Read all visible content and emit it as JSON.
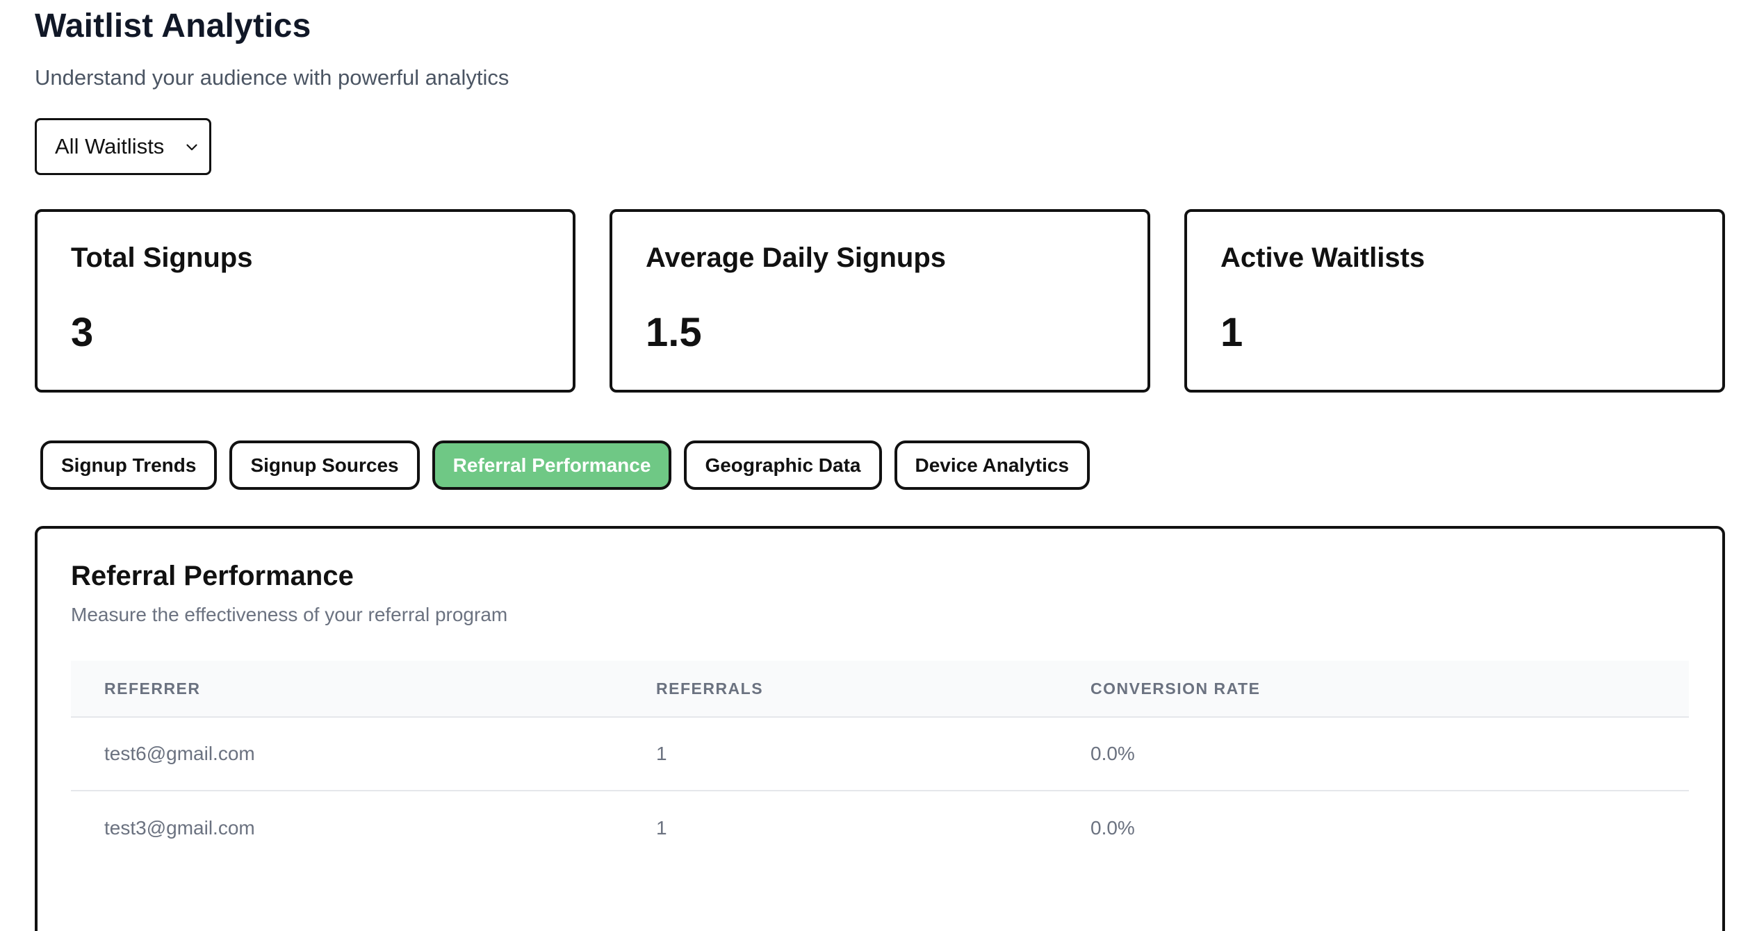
{
  "header": {
    "title": "Waitlist Analytics",
    "subtitle": "Understand your audience with powerful analytics"
  },
  "filter": {
    "selected": "All Waitlists"
  },
  "stats": [
    {
      "label": "Total Signups",
      "value": "3"
    },
    {
      "label": "Average Daily Signups",
      "value": "1.5"
    },
    {
      "label": "Active Waitlists",
      "value": "1"
    }
  ],
  "tabs": [
    {
      "label": "Signup Trends",
      "active": false
    },
    {
      "label": "Signup Sources",
      "active": false
    },
    {
      "label": "Referral Performance",
      "active": true
    },
    {
      "label": "Geographic Data",
      "active": false
    },
    {
      "label": "Device Analytics",
      "active": false
    }
  ],
  "panel": {
    "title": "Referral Performance",
    "description": "Measure the effectiveness of your referral program",
    "columns": [
      "REFERRER",
      "REFERRALS",
      "CONVERSION RATE"
    ],
    "rows": [
      [
        "test6@gmail.com",
        "1",
        "0.0%"
      ],
      [
        "test3@gmail.com",
        "1",
        "0.0%"
      ]
    ]
  },
  "colors": {
    "active_tab": "#6fc885",
    "border": "#111111",
    "muted_text": "#6b7280"
  }
}
